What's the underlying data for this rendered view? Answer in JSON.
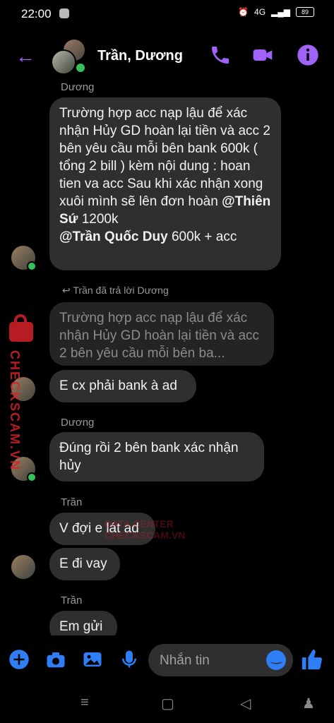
{
  "status": {
    "time": "22:00",
    "network": "4G",
    "battery": "89"
  },
  "header": {
    "title": "Trần, Dương"
  },
  "messages": [
    {
      "sender": "Dương",
      "text": "Trường hợp acc nạp lậu để xác nhận Hủy GD hoàn lại tiền và acc 2 bên yêu cầu mỗi bên bank 600k ( tổng 2 bill ) kèm nội dung : hoan tien va acc Sau khi xác nhận xong xuôi mình sẽ lên đơn hoàn @Thiên Sứ 1200k @Trần Quốc Duy 600k + acc"
    },
    {
      "reply_label": "Trần đã trả lời Dương",
      "quoted": "Trường hợp acc nạp lậu để xác nhận Hủy GD hoàn lại tiền và acc 2 bên yêu cầu mỗi bên ba...",
      "text": "E cx phải bank à ad"
    },
    {
      "sender": "Dương",
      "text": "Đúng rồi 2 bên bank xác nhận hủy"
    },
    {
      "sender": "Trần",
      "text1": "V đợi e lát ad",
      "text2": "E đi vay"
    },
    {
      "sender": "Trần",
      "text": "Em gửi"
    }
  ],
  "mentions": {
    "m1": "@Thiên Sứ",
    "m1_tail": "1200k",
    "m2": "@Trần Quốc Duy",
    "m2_tail": "600k + acc"
  },
  "composer": {
    "placeholder": "Nhắn tin"
  },
  "watermark": {
    "vertical": "CHECKSCAM.VN",
    "small": "DATA CENTER",
    "center": "CHECKSCAM.VN"
  },
  "colors": {
    "accent": "#a162f7",
    "blue": "#2f7ef5",
    "online": "#35c15a"
  }
}
